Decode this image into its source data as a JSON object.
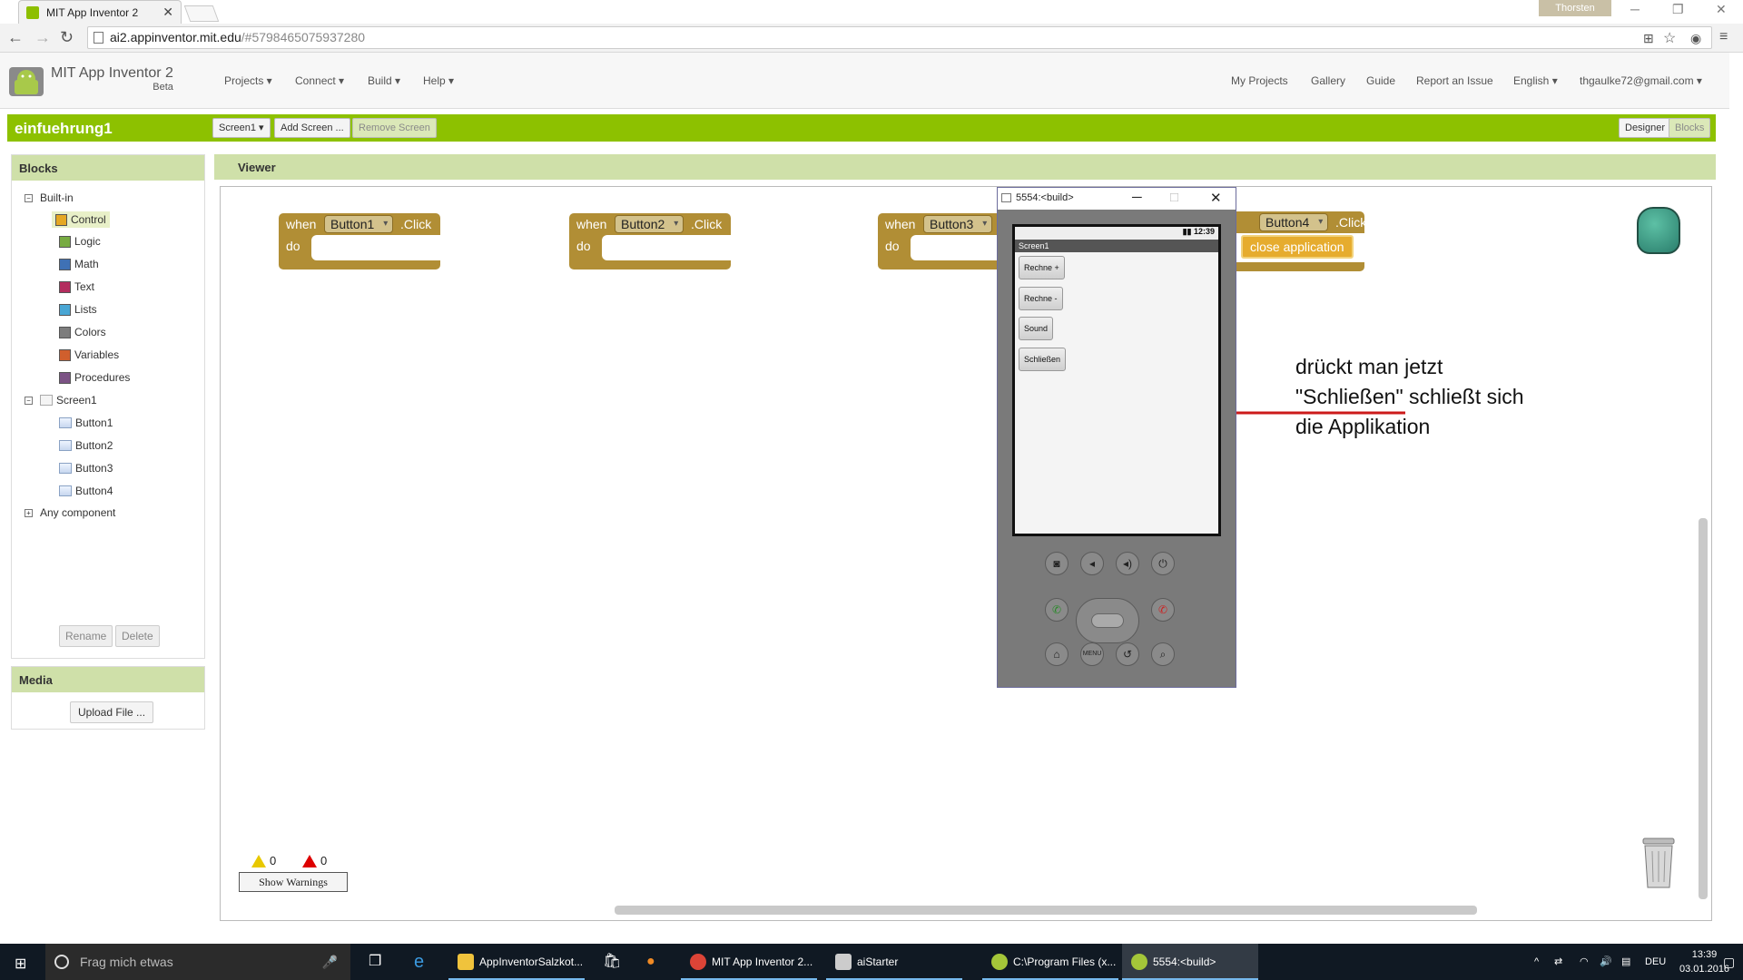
{
  "browser": {
    "tab_title": "MIT App Inventor 2",
    "tab_close": "✕",
    "profile": "Thorsten",
    "url_host": "ai2.appinventor.mit.edu",
    "url_path": "/#5798465075937280"
  },
  "app": {
    "brand": "MIT App Inventor 2",
    "beta": "Beta",
    "menu_left": [
      "Projects ▾",
      "Connect ▾",
      "Build ▾",
      "Help ▾"
    ],
    "menu_right": [
      "My Projects",
      "Gallery",
      "Guide",
      "Report an Issue",
      "English ▾",
      "thgaulke72@gmail.com ▾"
    ]
  },
  "project": {
    "name": "einfuehrung1",
    "screen_select": "Screen1 ▾",
    "add_screen": "Add Screen ...",
    "remove_screen": "Remove Screen",
    "designer": "Designer",
    "blocks": "Blocks"
  },
  "blocks_panel": {
    "title": "Blocks",
    "builtin": "Built-in",
    "builtin_items": [
      {
        "label": "Control",
        "color": "#e5a824"
      },
      {
        "label": "Logic",
        "color": "#77ab41"
      },
      {
        "label": "Math",
        "color": "#3f71b5"
      },
      {
        "label": "Text",
        "color": "#b32d5e"
      },
      {
        "label": "Lists",
        "color": "#49a6d4"
      },
      {
        "label": "Colors",
        "color": "#7d7d7d"
      },
      {
        "label": "Variables",
        "color": "#d05f2d"
      },
      {
        "label": "Procedures",
        "color": "#7c5385"
      }
    ],
    "screen": "Screen1",
    "components": [
      "Button1",
      "Button2",
      "Button3",
      "Button4"
    ],
    "any_component": "Any component",
    "rename": "Rename",
    "delete": "Delete"
  },
  "media_panel": {
    "title": "Media",
    "upload": "Upload File ..."
  },
  "viewer": {
    "title": "Viewer",
    "when": "when",
    "do": "do",
    "click": ".Click",
    "event_buttons": [
      "Button1",
      "Button2",
      "Button3",
      "Button4"
    ],
    "close_application": "close application",
    "warnings_count": "0",
    "errors_count": "0",
    "show_warnings": "Show Warnings"
  },
  "emulator": {
    "title": "5554:<build>",
    "time": "12:39",
    "screen_title": "Screen1",
    "buttons": [
      "Rechne +",
      "Rechne -",
      "Sound",
      "Schließen"
    ],
    "menu_key": "MENU"
  },
  "annotation": {
    "line1": "drückt man jetzt",
    "line2": "\"Schließen\" schließt sich",
    "line3": "die Applikation",
    "color": "#cc1a1a"
  },
  "taskbar": {
    "search": "Frag mich etwas",
    "tasks": [
      "AppInventorSalzkot...",
      "MIT App Inventor 2...",
      "aiStarter",
      "C:\\Program Files (x...",
      "5554:<build>"
    ],
    "lang": "DEU",
    "time": "13:39",
    "date": "03.01.2016"
  }
}
